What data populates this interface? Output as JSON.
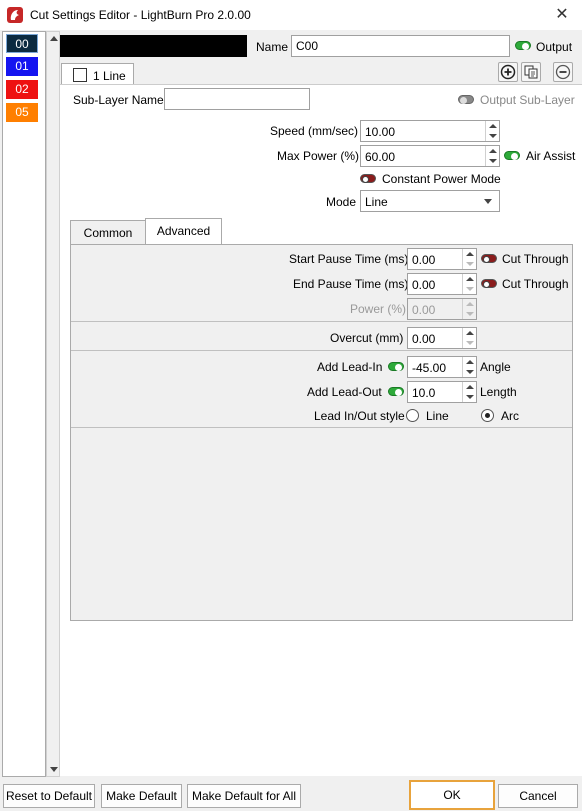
{
  "window": {
    "title": "Cut Settings Editor - LightBurn Pro 2.0.00",
    "close_glyph": "✕"
  },
  "layers": [
    {
      "label": "00",
      "color": "#0b2a40"
    },
    {
      "label": "01",
      "color": "#1414f0"
    },
    {
      "label": "02",
      "color": "#ee1111"
    },
    {
      "label": "05",
      "color": "#ff7f00"
    }
  ],
  "header": {
    "swatch_color": "#000000",
    "name_label": "Name",
    "name_value": "C00",
    "output_label": "Output"
  },
  "sublayer": {
    "tab_label": "1 Line",
    "name_label": "Sub-Layer Name",
    "name_value": "",
    "output_sub_label": "Output Sub-Layer",
    "add_icon": "⊕",
    "copy_icon": "copy",
    "remove_icon": "⊖"
  },
  "settings": {
    "speed_label": "Speed (mm/sec)",
    "speed_value": "10.00",
    "max_power_label": "Max Power (%)",
    "max_power_value": "60.00",
    "air_assist_label": "Air Assist",
    "constant_power_label": "Constant Power Mode",
    "mode_label": "Mode",
    "mode_value": "Line"
  },
  "tabs": {
    "common": "Common",
    "advanced": "Advanced"
  },
  "advanced": {
    "start_pause_label": "Start Pause Time (ms)",
    "start_pause_value": "0.00",
    "start_cut_through": "Cut Through",
    "end_pause_label": "End Pause Time (ms)",
    "end_pause_value": "0.00",
    "end_cut_through": "Cut Through",
    "power_label": "Power (%)",
    "power_value": "0.00",
    "overcut_label": "Overcut (mm)",
    "overcut_value": "0.00",
    "lead_in_label": "Add Lead-In",
    "lead_in_value": "-45.00",
    "lead_in_unit": "Angle",
    "lead_out_label": "Add Lead-Out",
    "lead_out_value": "10.0",
    "lead_out_unit": "Length",
    "lead_style_label": "Lead In/Out style",
    "lead_style_line": "Line",
    "lead_style_arc": "Arc"
  },
  "footer": {
    "reset_default": "Reset to Default",
    "make_default": "Make Default",
    "make_default_all": "Make Default for All",
    "ok": "OK",
    "cancel": "Cancel"
  }
}
